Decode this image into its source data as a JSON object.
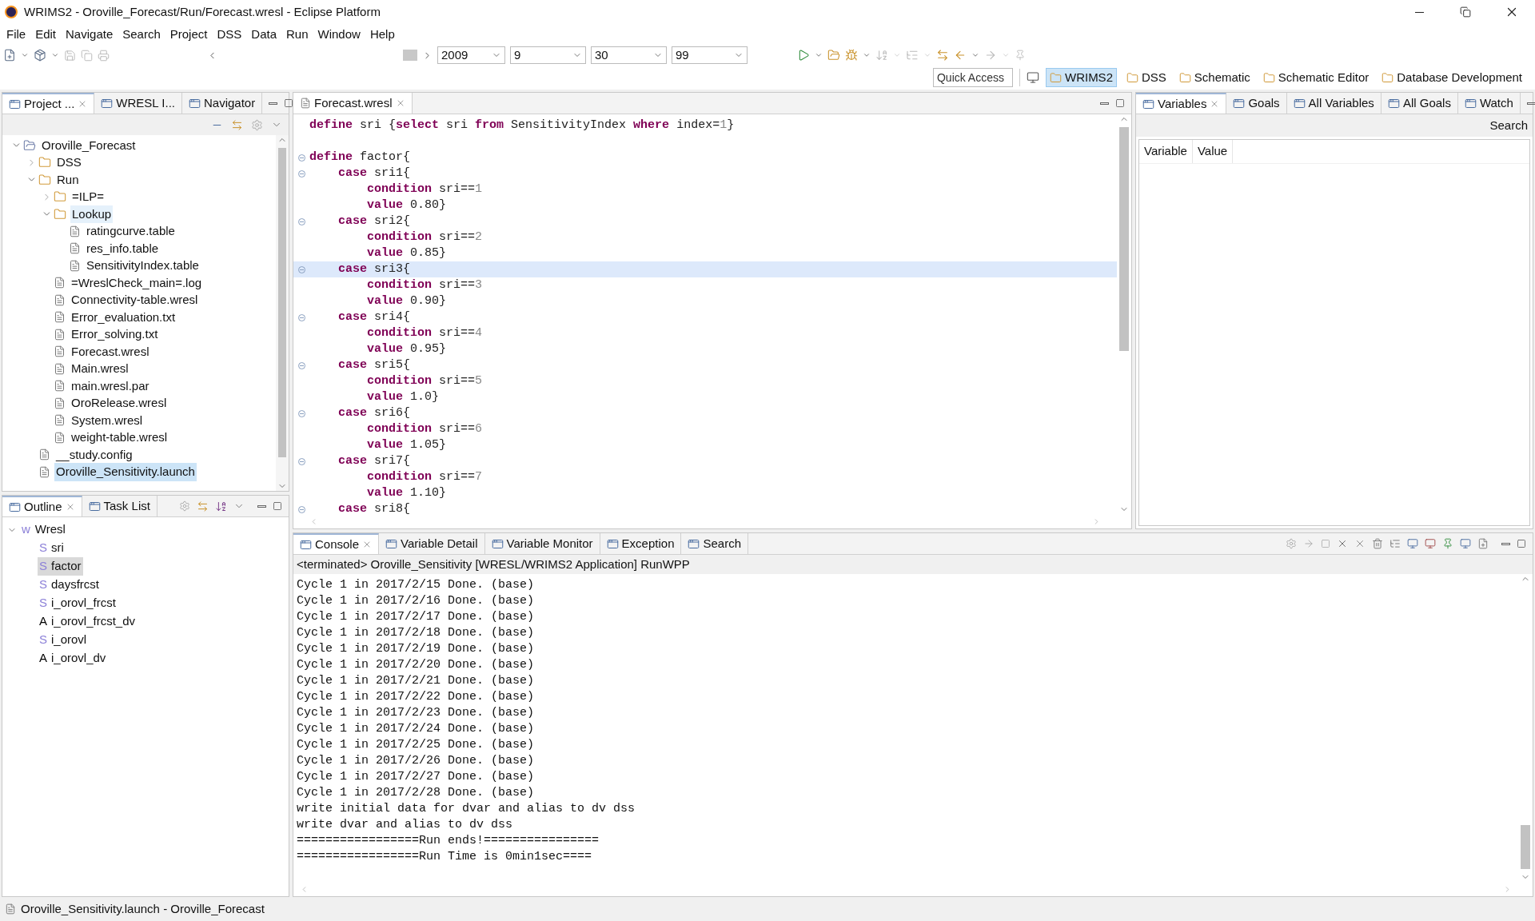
{
  "window": {
    "title": "WRIMS2 - Oroville_Forecast/Run/Forecast.wresl - Eclipse Platform"
  },
  "menu": [
    "File",
    "Edit",
    "Navigate",
    "Search",
    "Project",
    "DSS",
    "Data",
    "Run",
    "Window",
    "Help"
  ],
  "toolbar": {
    "combos": [
      "2009",
      "9",
      "30",
      "99"
    ]
  },
  "quick_access": {
    "placeholder": "Quick Access"
  },
  "perspectives": [
    {
      "label": "WRIMS2",
      "selected": true
    },
    {
      "label": "DSS",
      "selected": false
    },
    {
      "label": "Schematic",
      "selected": false
    },
    {
      "label": "Schematic Editor",
      "selected": false
    },
    {
      "label": "Database Development",
      "selected": false
    }
  ],
  "project_explorer": {
    "tabs": [
      {
        "label": "Project ...",
        "selected": true
      },
      {
        "label": "WRESL I...",
        "selected": false
      },
      {
        "label": "Navigator",
        "selected": false
      }
    ],
    "tree": [
      {
        "label": "Oroville_Forecast",
        "kind": "project",
        "expanded": true,
        "selected": false,
        "children": [
          {
            "label": "DSS",
            "kind": "folder",
            "expanded": false,
            "selected": false
          },
          {
            "label": "Run",
            "kind": "folder",
            "expanded": true,
            "selected": false,
            "children": [
              {
                "label": "=ILP=",
                "kind": "folder",
                "expanded": false,
                "selected": false
              },
              {
                "label": "Lookup",
                "kind": "folder",
                "expanded": true,
                "selected": false,
                "hovered": true,
                "children": [
                  {
                    "label": "ratingcurve.table",
                    "kind": "file",
                    "selected": false
                  },
                  {
                    "label": "res_info.table",
                    "kind": "file",
                    "selected": false
                  },
                  {
                    "label": "SensitivityIndex.table",
                    "kind": "file",
                    "selected": false
                  }
                ]
              },
              {
                "label": "=WreslCheck_main=.log",
                "kind": "file",
                "selected": false
              },
              {
                "label": "Connectivity-table.wresl",
                "kind": "file",
                "selected": false
              },
              {
                "label": "Error_evaluation.txt",
                "kind": "file",
                "selected": false
              },
              {
                "label": "Error_solving.txt",
                "kind": "file",
                "selected": false
              },
              {
                "label": "Forecast.wresl",
                "kind": "file",
                "selected": false
              },
              {
                "label": "Main.wresl",
                "kind": "file",
                "selected": false
              },
              {
                "label": "main.wresl.par",
                "kind": "file",
                "selected": false
              },
              {
                "label": "OroRelease.wresl",
                "kind": "file",
                "selected": false
              },
              {
                "label": "System.wresl",
                "kind": "file",
                "selected": false
              },
              {
                "label": "weight-table.wresl",
                "kind": "file",
                "selected": false
              }
            ]
          },
          {
            "label": "__study.config",
            "kind": "file",
            "selected": false
          },
          {
            "label": "Oroville_Sensitivity.launch",
            "kind": "file",
            "selected": true
          }
        ]
      }
    ]
  },
  "outline": {
    "tabs": [
      {
        "label": "Outline",
        "selected": true
      },
      {
        "label": "Task List",
        "selected": false
      }
    ],
    "root": {
      "icon": "w",
      "label": "Wresl",
      "expanded": true
    },
    "items": [
      {
        "icon": "S",
        "label": "sri",
        "color": "#8c80d8",
        "selected": false
      },
      {
        "icon": "S",
        "label": "factor",
        "color": "#8c80d8",
        "selected": true
      },
      {
        "icon": "S",
        "label": "daysfrcst",
        "color": "#8c80d8",
        "selected": false
      },
      {
        "icon": "S",
        "label": "i_orovl_frcst",
        "color": "#8c80d8",
        "selected": false
      },
      {
        "icon": "A",
        "label": "i_orovl_frcst_dv",
        "color": "#000000",
        "selected": false
      },
      {
        "icon": "S",
        "label": "i_orovl",
        "color": "#8c80d8",
        "selected": false
      },
      {
        "icon": "A",
        "label": "i_orovl_dv",
        "color": "#000000",
        "selected": false
      }
    ]
  },
  "editor": {
    "tab": {
      "label": "Forecast.wresl",
      "selected": true
    },
    "lines": [
      {
        "kind": "top",
        "fold": false,
        "current": false,
        "tokens": [
          {
            "kind": "keyword",
            "text": "define"
          },
          {
            "kind": "plain",
            "text": " sri {"
          },
          {
            "kind": "keyword",
            "text": "select"
          },
          {
            "kind": "plain",
            "text": " sri "
          },
          {
            "kind": "keyword",
            "text": "from"
          },
          {
            "kind": "plain",
            "text": " SensitivityIndex "
          },
          {
            "kind": "keyword",
            "text": "where"
          },
          {
            "kind": "plain",
            "text": " index="
          },
          {
            "kind": "number",
            "text": "1"
          },
          {
            "kind": "plain",
            "text": "}"
          }
        ]
      },
      {
        "fold": false,
        "current": false
      },
      {
        "kind": "top",
        "fold": true,
        "current": false,
        "tokens": [
          {
            "kind": "keyword",
            "text": "define"
          },
          {
            "kind": "plain",
            "text": " factor{"
          }
        ]
      },
      {
        "kind": "case",
        "fold": true,
        "current": false,
        "tokens": [
          {
            "kind": "keyword",
            "text": "case"
          },
          {
            "kind": "plain",
            "text": " sri1{"
          }
        ]
      },
      {
        "kind": "body",
        "fold": false,
        "current": false,
        "tokens": [
          {
            "kind": "keyword",
            "text": "condition"
          },
          {
            "kind": "plain",
            "text": " sri=="
          },
          {
            "kind": "number",
            "text": "1"
          }
        ]
      },
      {
        "kind": "body",
        "fold": false,
        "current": false,
        "tokens": [
          {
            "kind": "keyword",
            "text": "value"
          },
          {
            "kind": "plain",
            "text": " 0.80}"
          }
        ]
      },
      {
        "kind": "case",
        "fold": true,
        "current": false,
        "tokens": [
          {
            "kind": "keyword",
            "text": "case"
          },
          {
            "kind": "plain",
            "text": " sri2{"
          }
        ]
      },
      {
        "kind": "body",
        "fold": false,
        "current": false,
        "tokens": [
          {
            "kind": "keyword",
            "text": "condition"
          },
          {
            "kind": "plain",
            "text": " sri=="
          },
          {
            "kind": "number",
            "text": "2"
          }
        ]
      },
      {
        "kind": "body",
        "fold": false,
        "current": false,
        "tokens": [
          {
            "kind": "keyword",
            "text": "value"
          },
          {
            "kind": "plain",
            "text": " 0.85}"
          }
        ]
      },
      {
        "kind": "case",
        "fold": true,
        "current": true,
        "tokens": [
          {
            "kind": "keyword",
            "text": "case"
          },
          {
            "kind": "plain",
            "text": " sri3{"
          }
        ]
      },
      {
        "kind": "body",
        "fold": false,
        "current": false,
        "tokens": [
          {
            "kind": "keyword",
            "text": "condition"
          },
          {
            "kind": "plain",
            "text": " sri=="
          },
          {
            "kind": "number",
            "text": "3"
          }
        ]
      },
      {
        "kind": "body",
        "fold": false,
        "current": false,
        "tokens": [
          {
            "kind": "keyword",
            "text": "value"
          },
          {
            "kind": "plain",
            "text": " 0.90}"
          }
        ]
      },
      {
        "kind": "case",
        "fold": true,
        "current": false,
        "tokens": [
          {
            "kind": "keyword",
            "text": "case"
          },
          {
            "kind": "plain",
            "text": " sri4{"
          }
        ]
      },
      {
        "kind": "body",
        "fold": false,
        "current": false,
        "tokens": [
          {
            "kind": "keyword",
            "text": "condition"
          },
          {
            "kind": "plain",
            "text": " sri=="
          },
          {
            "kind": "number",
            "text": "4"
          }
        ]
      },
      {
        "kind": "body",
        "fold": false,
        "current": false,
        "tokens": [
          {
            "kind": "keyword",
            "text": "value"
          },
          {
            "kind": "plain",
            "text": " 0.95}"
          }
        ]
      },
      {
        "kind": "case",
        "fold": true,
        "current": false,
        "tokens": [
          {
            "kind": "keyword",
            "text": "case"
          },
          {
            "kind": "plain",
            "text": " sri5{"
          }
        ]
      },
      {
        "kind": "body",
        "fold": false,
        "current": false,
        "tokens": [
          {
            "kind": "keyword",
            "text": "condition"
          },
          {
            "kind": "plain",
            "text": " sri=="
          },
          {
            "kind": "number",
            "text": "5"
          }
        ]
      },
      {
        "kind": "body",
        "fold": false,
        "current": false,
        "tokens": [
          {
            "kind": "keyword",
            "text": "value"
          },
          {
            "kind": "plain",
            "text": " 1.0}"
          }
        ]
      },
      {
        "kind": "case",
        "fold": true,
        "current": false,
        "tokens": [
          {
            "kind": "keyword",
            "text": "case"
          },
          {
            "kind": "plain",
            "text": " sri6{"
          }
        ]
      },
      {
        "kind": "body",
        "fold": false,
        "current": false,
        "tokens": [
          {
            "kind": "keyword",
            "text": "condition"
          },
          {
            "kind": "plain",
            "text": " sri=="
          },
          {
            "kind": "number",
            "text": "6"
          }
        ]
      },
      {
        "kind": "body",
        "fold": false,
        "current": false,
        "tokens": [
          {
            "kind": "keyword",
            "text": "value"
          },
          {
            "kind": "plain",
            "text": " 1.05}"
          }
        ]
      },
      {
        "kind": "case",
        "fold": true,
        "current": false,
        "tokens": [
          {
            "kind": "keyword",
            "text": "case"
          },
          {
            "kind": "plain",
            "text": " sri7{"
          }
        ]
      },
      {
        "kind": "body",
        "fold": false,
        "current": false,
        "tokens": [
          {
            "kind": "keyword",
            "text": "condition"
          },
          {
            "kind": "plain",
            "text": " sri=="
          },
          {
            "kind": "number",
            "text": "7"
          }
        ]
      },
      {
        "kind": "body",
        "fold": false,
        "current": false,
        "tokens": [
          {
            "kind": "keyword",
            "text": "value"
          },
          {
            "kind": "plain",
            "text": " 1.10}"
          }
        ]
      },
      {
        "kind": "case",
        "fold": true,
        "current": false,
        "tokens": [
          {
            "kind": "keyword",
            "text": "case"
          },
          {
            "kind": "plain",
            "text": " sri8{"
          }
        ]
      }
    ]
  },
  "variables": {
    "tabs": [
      {
        "label": "Variables",
        "selected": true
      },
      {
        "label": "Goals",
        "selected": false
      },
      {
        "label": "All Variables",
        "selected": false
      },
      {
        "label": "All Goals",
        "selected": false
      },
      {
        "label": "Watch",
        "selected": false
      }
    ],
    "search": "Search",
    "columns": [
      "Variable",
      "Value"
    ]
  },
  "console": {
    "tabs": [
      {
        "label": "Console",
        "selected": true
      },
      {
        "label": "Variable Detail",
        "selected": false
      },
      {
        "label": "Variable Monitor",
        "selected": false
      },
      {
        "label": "Exception",
        "selected": false
      },
      {
        "label": "Search",
        "selected": false
      }
    ],
    "process": "<terminated> Oroville_Sensitivity [WRESL/WRIMS2 Application] RunWPP",
    "lines": [
      "Cycle 1 in 2017/2/15 Done. (base)",
      "Cycle 1 in 2017/2/16 Done. (base)",
      "Cycle 1 in 2017/2/17 Done. (base)",
      "Cycle 1 in 2017/2/18 Done. (base)",
      "Cycle 1 in 2017/2/19 Done. (base)",
      "Cycle 1 in 2017/2/20 Done. (base)",
      "Cycle 1 in 2017/2/21 Done. (base)",
      "Cycle 1 in 2017/2/22 Done. (base)",
      "Cycle 1 in 2017/2/23 Done. (base)",
      "Cycle 1 in 2017/2/24 Done. (base)",
      "Cycle 1 in 2017/2/25 Done. (base)",
      "Cycle 1 in 2017/2/26 Done. (base)",
      "Cycle 1 in 2017/2/27 Done. (base)",
      "Cycle 1 in 2017/2/28 Done. (base)",
      "write initial data for dvar and alias to dv dss",
      "write dvar and alias to dv dss",
      "=================Run ends!================",
      "=================Run Time is 0min1sec===="
    ]
  },
  "status_bar": "Oroville_Sensitivity.launch - Oroville_Forecast"
}
